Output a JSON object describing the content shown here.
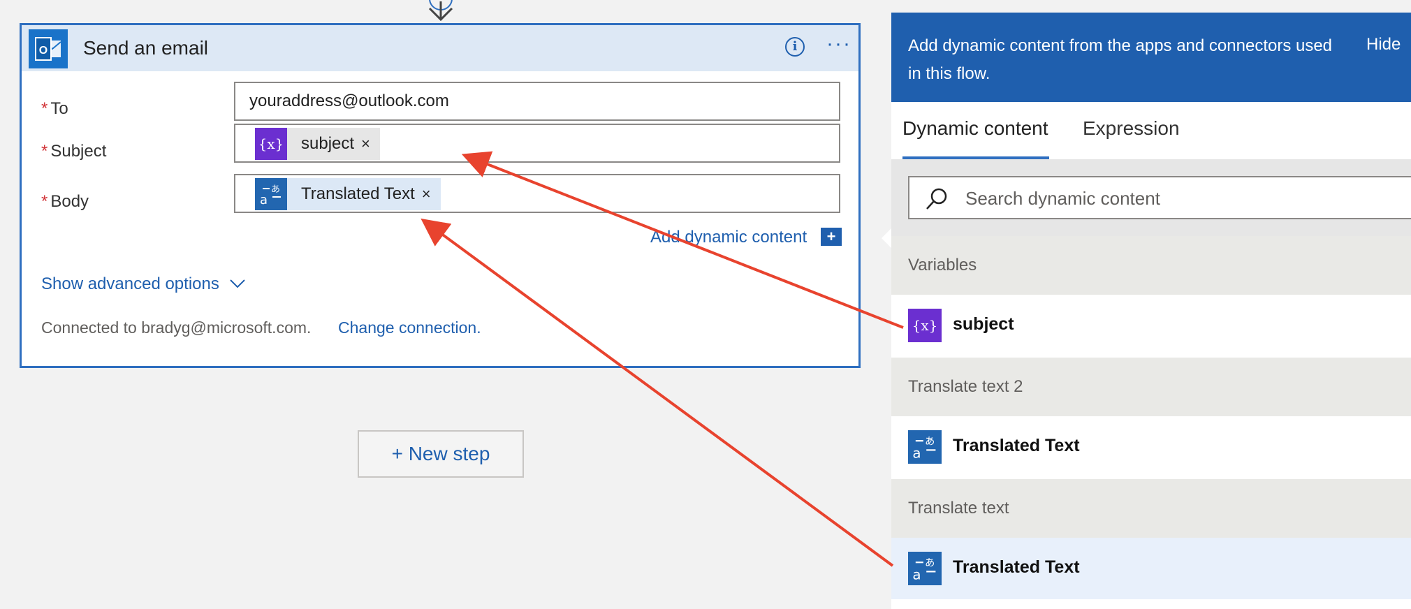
{
  "email_card": {
    "title": "Send an email",
    "info_glyph": "i",
    "more_glyph": "···",
    "fields": {
      "to": {
        "label": "To",
        "value": "youraddress@outlook.com"
      },
      "subject": {
        "label": "Subject",
        "token": "subject",
        "token_icon": "variable-icon"
      },
      "body": {
        "label": "Body",
        "token": "Translated Text",
        "token_icon": "translator-icon"
      }
    },
    "required_mark": "*",
    "remove_glyph": "×",
    "add_dynamic_content": "Add dynamic content",
    "add_glyph": "+",
    "show_advanced": "Show advanced options",
    "connected_text": "Connected to bradyg@microsoft.com.",
    "change_connection": "Change connection."
  },
  "new_step_label": "+ New step",
  "panel": {
    "header_text": "Add dynamic content from the apps and connectors used in this flow.",
    "hide_label": "Hide",
    "tabs": [
      "Dynamic content",
      "Expression"
    ],
    "active_tab": "Dynamic content",
    "search_placeholder": "Search dynamic content",
    "groups": [
      {
        "header": "Variables",
        "item": "subject",
        "icon": "variable-icon"
      },
      {
        "header": "Translate text 2",
        "item": "Translated Text",
        "icon": "translator-icon"
      },
      {
        "header": "Translate text",
        "item": "Translated Text",
        "icon": "translator-icon"
      }
    ]
  },
  "colors": {
    "accent": "#1f5fae",
    "variable_purple": "#6b2fd0",
    "annotation_arrow": "#e8432e"
  }
}
